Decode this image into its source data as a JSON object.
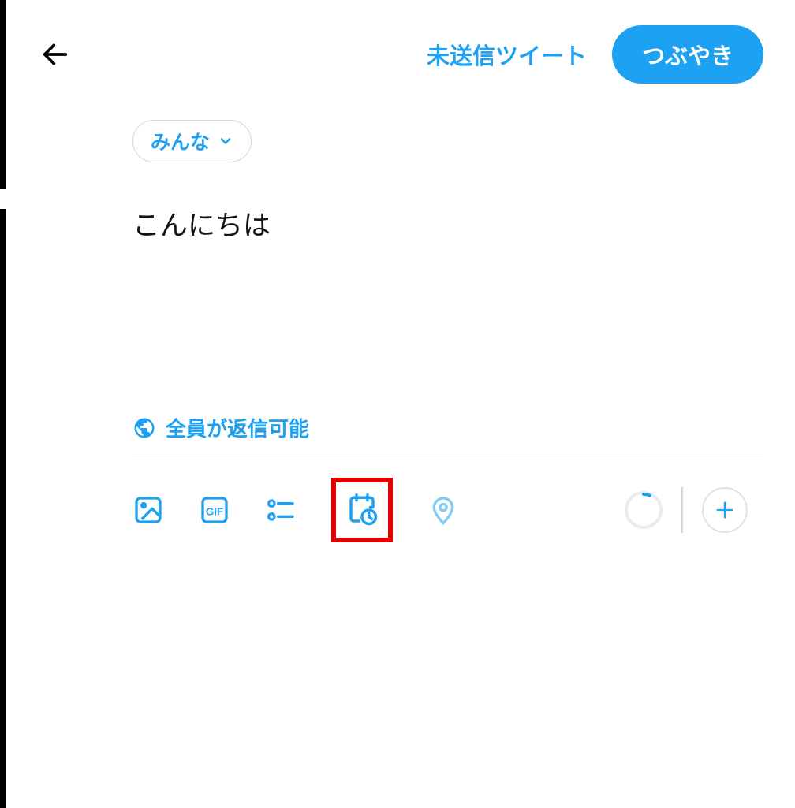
{
  "header": {
    "drafts_label": "未送信ツイート",
    "tweet_button_label": "つぶやき"
  },
  "composer": {
    "audience_label": "みんな",
    "tweet_text": "こんにちは",
    "reply_settings_label": "全員が返信可能"
  },
  "icons": {
    "back": "back-arrow",
    "globe": "globe",
    "image": "image",
    "gif": "gif",
    "poll": "poll",
    "schedule": "schedule",
    "location": "location",
    "add": "add"
  },
  "colors": {
    "primary": "#1DA1F2",
    "highlight_border": "#E30000"
  }
}
